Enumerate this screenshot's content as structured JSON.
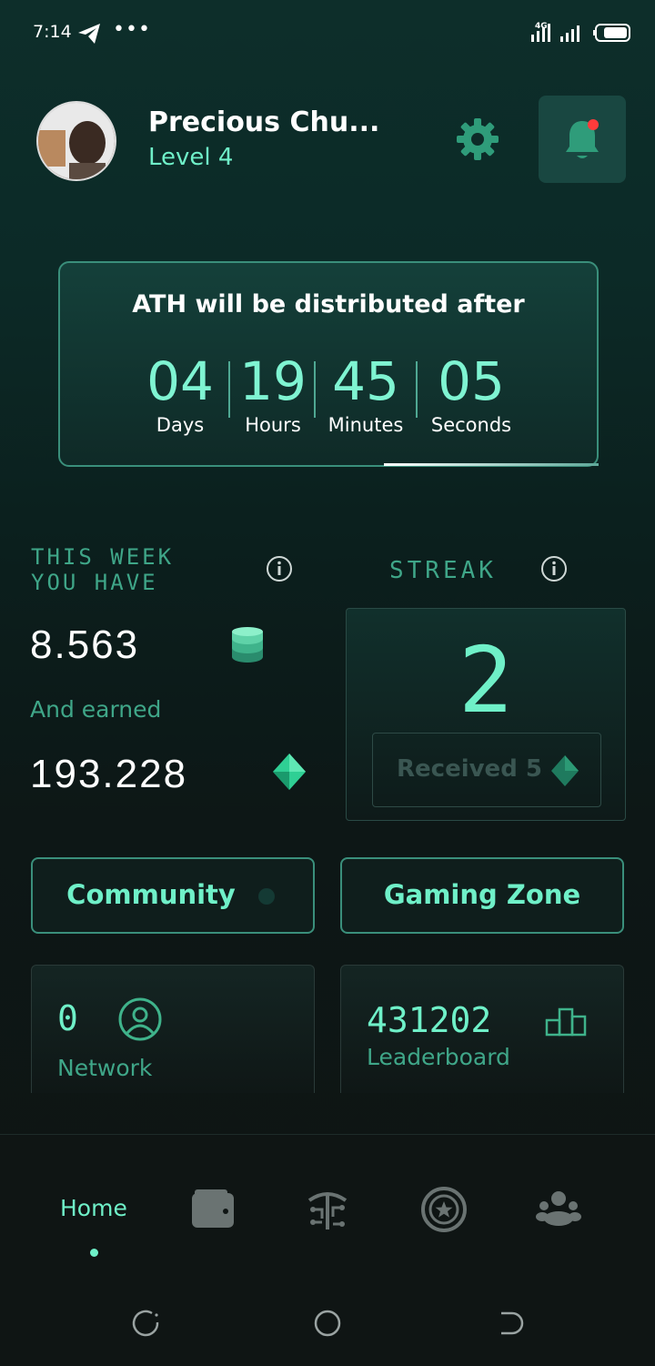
{
  "status_bar": {
    "time": "7:14",
    "dots": "•••",
    "network": "4G"
  },
  "header": {
    "name": "Precious Chu...",
    "level": "Level 4"
  },
  "countdown": {
    "title": "ATH will be distributed after",
    "units": [
      {
        "value": "04",
        "label": "Days"
      },
      {
        "value": "19",
        "label": "Hours"
      },
      {
        "value": "45",
        "label": "Minutes"
      },
      {
        "value": "05",
        "label": "Seconds"
      }
    ]
  },
  "week": {
    "label_line1": "THIS WEEK",
    "label_line2": "YOU HAVE",
    "amount": "8.563",
    "earned_label": "And earned",
    "earned_amount": "193.228"
  },
  "streak": {
    "label": "STREAK",
    "value": "2",
    "received": "Received 5"
  },
  "buttons": {
    "community": "Community",
    "gaming_zone": "Gaming Zone"
  },
  "tiles": {
    "network": {
      "value": "0",
      "label": "Network"
    },
    "leaderboard": {
      "value": "431202",
      "label": "Leaderboard"
    }
  },
  "nav": {
    "home": "Home"
  },
  "colors": {
    "accent": "#6ff0c8",
    "muted_accent": "#3fa688",
    "notification": "#ff3b3b"
  }
}
